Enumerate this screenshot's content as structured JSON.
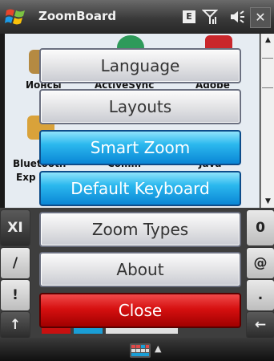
{
  "title_bar": {
    "app_title": "ZoomBoard",
    "indicator_label": "E",
    "icons": [
      "windows-start-icon",
      "signal-icon",
      "volume-icon",
      "close-icon"
    ],
    "close_glyph": "✕"
  },
  "desktop": {
    "apps": [
      {
        "label": "Ионсы"
      },
      {
        "label": "ActiveSync"
      },
      {
        "label": "Adobe"
      },
      {
        "label": "Bluetooth"
      },
      {
        "label": "Exp"
      },
      {
        "label": "Comm"
      },
      {
        "label": "Java"
      }
    ]
  },
  "keyboard": {
    "left_keys": [
      "XI",
      "/",
      "!",
      "↑"
    ],
    "right_keys": [
      "0",
      "@",
      ".",
      "←"
    ]
  },
  "menu": {
    "items": [
      {
        "label": "Language",
        "style": "gray"
      },
      {
        "label": "Layouts",
        "style": "gray"
      },
      {
        "label": "Smart Zoom",
        "style": "blue"
      },
      {
        "label": "Default Keyboard",
        "style": "blue"
      },
      {
        "label": "Zoom Types",
        "style": "gray"
      },
      {
        "label": "About",
        "style": "gray"
      },
      {
        "label": "Close",
        "style": "red"
      }
    ]
  },
  "bottom_bar": {
    "arrow_glyph": "▲"
  },
  "colors": {
    "gray_button": "#e6e6e8",
    "blue_button": "#2bb8ee",
    "red_button": "#d61010"
  }
}
